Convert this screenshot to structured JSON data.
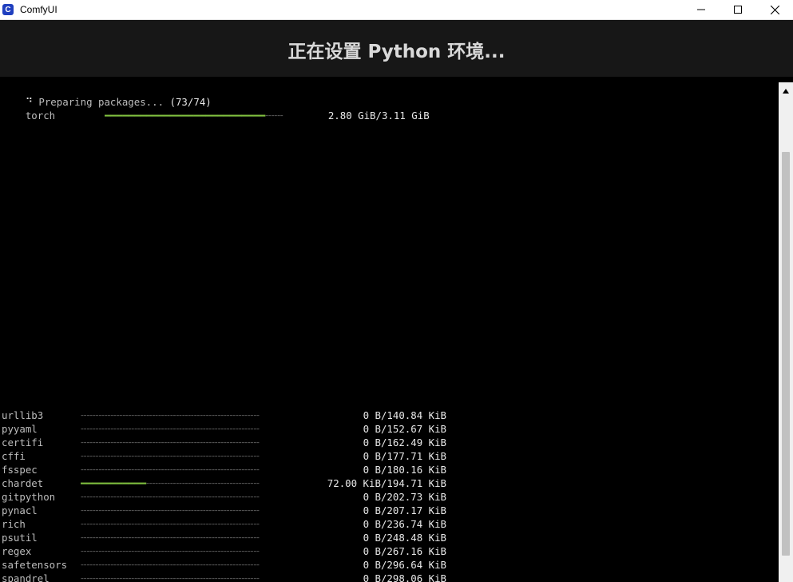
{
  "window": {
    "title": "ComfyUI",
    "icon_letter": "C",
    "controls": [
      "minimize-icon",
      "maximize-icon",
      "close-icon"
    ]
  },
  "header": {
    "title": "正在设置 Python 环境..."
  },
  "terminal": {
    "spinner": "⠙",
    "preparing_text": "Preparing packages...",
    "preparing_count": "(73/74)",
    "active": {
      "name": "torch",
      "progress": 0.9,
      "size": "2.80 GiB/3.11 GiB"
    },
    "packages": [
      {
        "name": "urllib3",
        "progress": 0,
        "size": "0 B/140.84 KiB"
      },
      {
        "name": "pyyaml",
        "progress": 0,
        "size": "0 B/152.67 KiB"
      },
      {
        "name": "certifi",
        "progress": 0,
        "size": "0 B/162.49 KiB"
      },
      {
        "name": "cffi",
        "progress": 0,
        "size": "0 B/177.71 KiB"
      },
      {
        "name": "fsspec",
        "progress": 0,
        "size": "0 B/180.16 KiB"
      },
      {
        "name": "chardet",
        "progress": 0.37,
        "size": "72.00 KiB/194.71 KiB"
      },
      {
        "name": "gitpython",
        "progress": 0,
        "size": "0 B/202.73 KiB"
      },
      {
        "name": "pynacl",
        "progress": 0,
        "size": "0 B/207.17 KiB"
      },
      {
        "name": "rich",
        "progress": 0,
        "size": "0 B/236.74 KiB"
      },
      {
        "name": "psutil",
        "progress": 0,
        "size": "0 B/248.48 KiB"
      },
      {
        "name": "regex",
        "progress": 0,
        "size": "0 B/267.16 KiB"
      },
      {
        "name": "safetensors",
        "progress": 0,
        "size": "0 B/296.64 KiB"
      },
      {
        "name": "spandrel",
        "progress": 0,
        "size": "0 B/298.06 KiB"
      }
    ]
  },
  "colors": {
    "bar_filled": "#7fbf3f",
    "bar_empty": "#5a5a5a",
    "header_bg": "#171717",
    "terminal_bg": "#000000"
  }
}
